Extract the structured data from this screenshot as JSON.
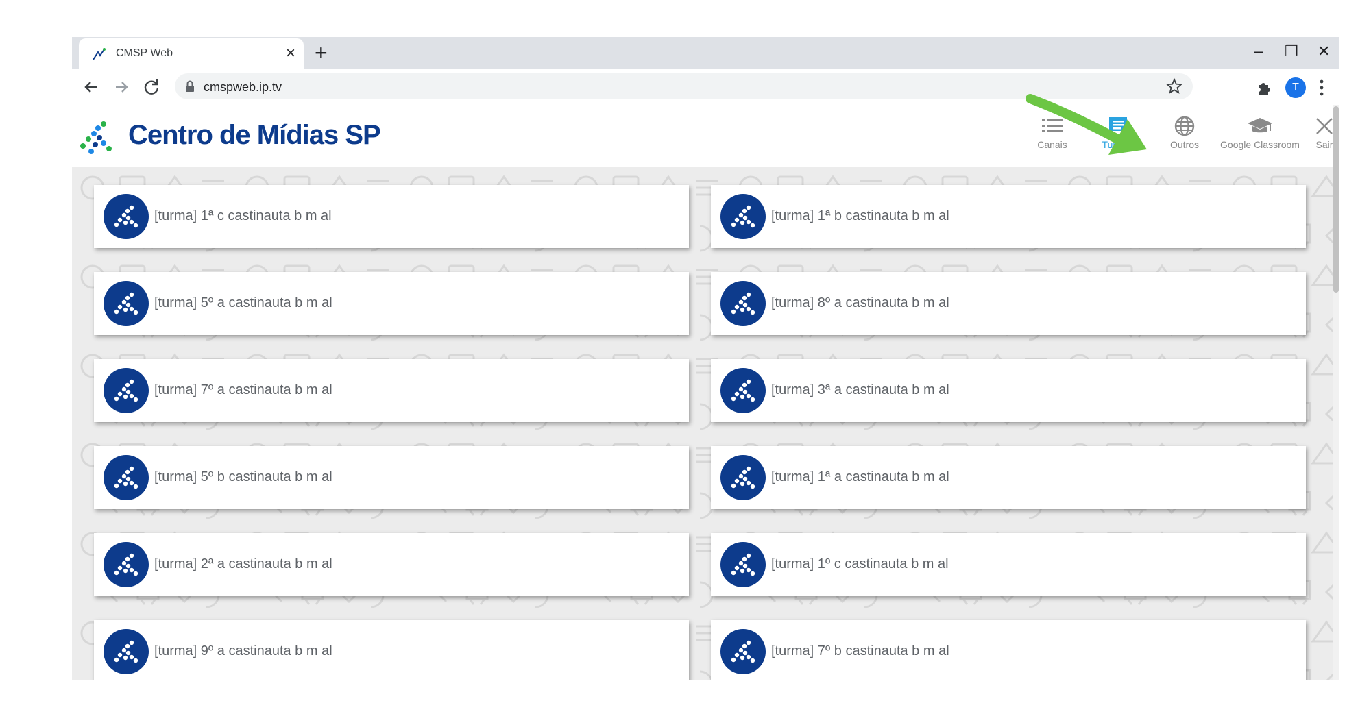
{
  "browser": {
    "tab_title": "CMSP Web",
    "url": "cmspweb.ip.tv",
    "profile_initial": "T"
  },
  "header": {
    "brand": "Centro de Mídias SP",
    "nav": [
      {
        "label": "Canais",
        "icon": "list-icon"
      },
      {
        "label": "Turmas",
        "icon": "chat-icon",
        "active": true
      },
      {
        "label": "Outros",
        "icon": "globe-icon"
      },
      {
        "label": "Google Classroom",
        "icon": "graduation-cap-icon"
      },
      {
        "label": "Sair",
        "icon": "close-icon"
      }
    ]
  },
  "classes": [
    {
      "label": "[turma] 1ª c castinauta b m al"
    },
    {
      "label": "[turma] 1ª b castinauta b m al"
    },
    {
      "label": "[turma] 5º a castinauta b m al"
    },
    {
      "label": "[turma] 8º a castinauta b m al"
    },
    {
      "label": "[turma] 7º a castinauta b m al"
    },
    {
      "label": "[turma] 3ª a castinauta b m al"
    },
    {
      "label": "[turma] 5º b castinauta b m al"
    },
    {
      "label": "[turma] 1ª a castinauta b m al"
    },
    {
      "label": "[turma] 2ª a castinauta b m al"
    },
    {
      "label": "[turma] 1º c castinauta b m al"
    },
    {
      "label": "[turma] 9º a castinauta b m al"
    },
    {
      "label": "[turma] 7º b castinauta b m al"
    }
  ],
  "colors": {
    "brand": "#0d3b8c",
    "active_nav": "#2aa3e0",
    "annotation_arrow": "#6cc644"
  }
}
